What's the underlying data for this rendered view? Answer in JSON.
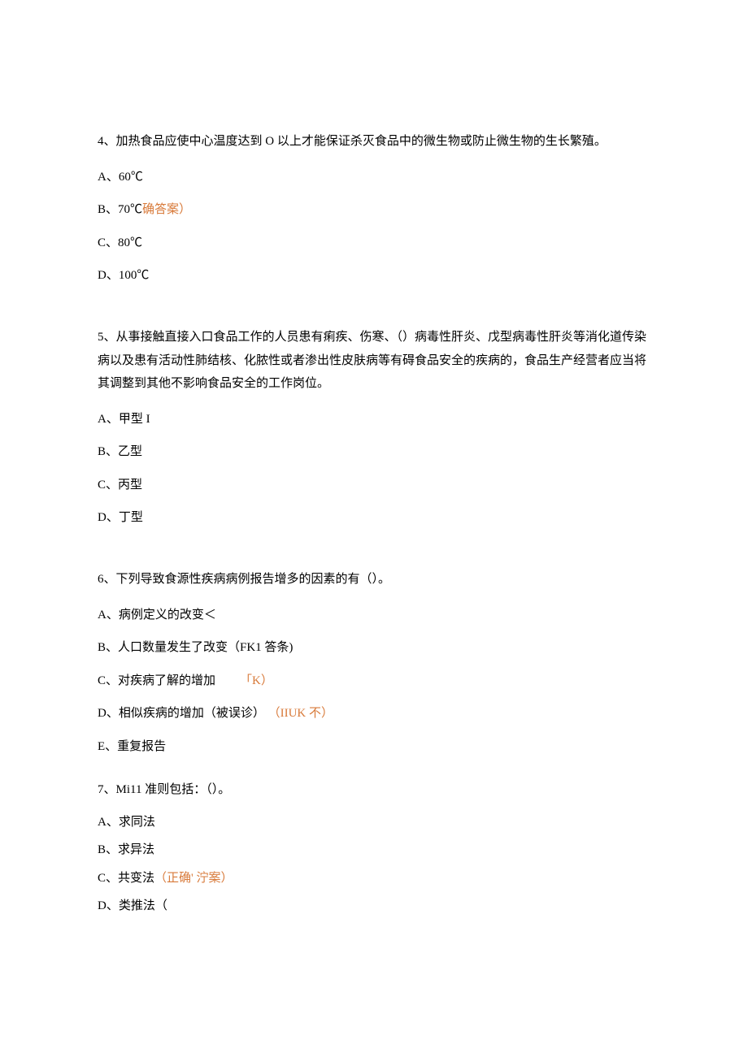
{
  "q4": {
    "text": "4、加热食品应使中心温度达到 O 以上才能保证杀灭食品中的微生物或防止微生物的生长繁殖。",
    "a": "A、60℃",
    "b_prefix": "B、70℃",
    "b_mark": "确答案）",
    "c": "C、80℃",
    "d": "D、100℃"
  },
  "q5": {
    "text": "5、从事接触直接入口食品工作的人员患有痢疾、伤寒、（）病毒性肝炎、戊型病毒性肝炎等消化道传染病以及患有活动性肺结核、化脓性或者渗出性皮肤病等有碍食品安全的疾病的，食品生产经营者应当将其调整到其他不影响食品安全的工作岗位。",
    "a": "A、甲型 I",
    "b": "B、乙型",
    "c": "C、丙型",
    "d": "D、丁型"
  },
  "q6": {
    "text": "6、下列导致食源性疾病病例报告增多的因素的有（）。",
    "a": "A、病例定义的改变＜",
    "b": "B、人口数量发生了改变（FK1 答条)",
    "c_prefix": "C、对疾病了解的增加",
    "c_mark": "「K）",
    "d_prefix": "D、相似疾病的增加（被误诊）",
    "d_mark": "（IIUK 不）",
    "e": "E、重复报告"
  },
  "q7": {
    "text": "7、Mi11 准则包括：（）。",
    "a": "A、求同法",
    "b": "B、求异法",
    "c_prefix": "C、共变法",
    "c_mark": "（正确' 泞案）",
    "d": "D、类推法（"
  }
}
